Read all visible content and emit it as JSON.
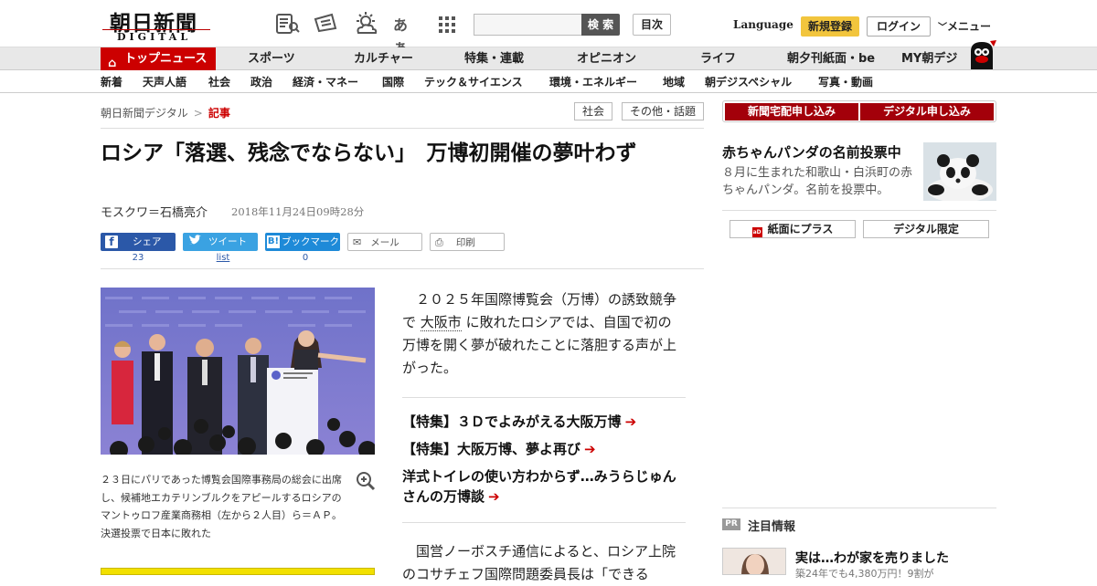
{
  "header": {
    "logo_jp": "朝日新聞",
    "logo_en": "DIGITAL",
    "kana_icon": "あぁ",
    "search_placeholder": "",
    "search_button": "検 索",
    "toc_button": "目次",
    "language": "Language",
    "register": "新規登録",
    "login": "ログイン",
    "menu": "メニュー"
  },
  "nav_primary": {
    "top": "トップニュース",
    "items": [
      "スポーツ",
      "カルチャー",
      "特集・連載",
      "オピニオン",
      "ライフ",
      "朝夕刊紙面・be",
      "MY朝デジ"
    ]
  },
  "nav_secondary": {
    "items": [
      "新着",
      "天声人語",
      "社会",
      "政治",
      "経済・マネー",
      "国際",
      "テック＆サイエンス",
      "環境・エネルギー",
      "地域",
      "朝デジスペシャル",
      "写真・動画"
    ]
  },
  "breadcrumb": {
    "home": "朝日新聞デジタル",
    "sep": ">",
    "current": "記事"
  },
  "tags": [
    "社会",
    "その他・話題"
  ],
  "article": {
    "headline": "ロシア「落選、残念でならない」　万博初開催の夢叶わず",
    "byline": "モスクワ＝石橋亮介",
    "date": "2018年11月24日09時28分",
    "share": {
      "facebook": "シェア",
      "facebook_count": "23",
      "twitter": "ツイート",
      "twitter_count": "list",
      "hatena": "ブックマーク",
      "hatena_count": "0",
      "mail": "メール",
      "print": "印刷"
    },
    "caption": "２３日にパリであった博覧会国際事務局の総会に出席し、候補地エカテリンブルクをアピールするロシアのマントゥロフ産業商務相（左から２人目）ら＝ＡＰ。決選投票で日本に敗れた",
    "lead_a": "　２０２５年国際博覧会（万博）の誘致競争で",
    "lead_link": "大阪市",
    "lead_b": "に敗れたロシアでは、自国で初の万博を開く夢が破れたことに落胆する声が上がった。",
    "related": [
      "【特集】３Ｄでよみがえる大阪万博",
      "【特集】大阪万博、夢よ再び",
      "洋式トイレの使い方わからず…みうらじゅんさんの万博談"
    ],
    "para2": "　国営ノーボスチ通信によると、ロシア上院のコサチェフ国際問題委員長は「できる"
  },
  "sidebar": {
    "sub_newspaper": "新聞宅配申し込み",
    "sub_digital": "デジタル申し込み",
    "panda_title": "赤ちゃんパンダの名前投票中",
    "panda_desc": "８月に生まれた和歌山・白浜町の赤ちゃんパンダ。名前を投票中。",
    "paper_plus": "紙面にプラス",
    "digital_only": "デジタル限定",
    "pr_badge": "PR",
    "pr_title": "注目情報",
    "pr_head": "実は…わが家を売りました",
    "pr_sub": "築24年でも4,380万円！9割が",
    "paper_plus_icon": "aD"
  }
}
